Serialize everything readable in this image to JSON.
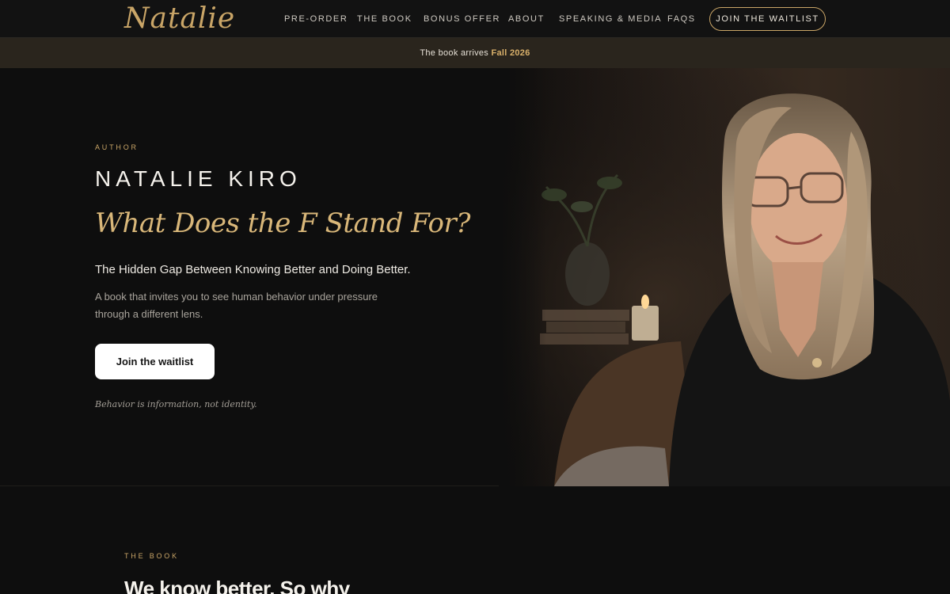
{
  "header": {
    "logo_text": "Natalie",
    "nav": [
      {
        "label": "PRE-ORDER"
      },
      {
        "label": "THE BOOK"
      },
      {
        "label": "BONUS OFFER"
      },
      {
        "label": "ABOUT"
      },
      {
        "label": "SPEAKING & MEDIA"
      },
      {
        "label": "FAQS"
      }
    ],
    "cta_label": "JOIN THE WAITLIST"
  },
  "announcement": {
    "text": "The book arrives",
    "highlight": "Fall 2026"
  },
  "hero": {
    "eyebrow": "AUTHOR",
    "name": "NATALIE KIRO",
    "title": "What Does the F Stand For?",
    "subtitle": "The Hidden Gap Between Knowing Better and Doing Better.",
    "description": "A book that invites you to see human behavior under pressure through a different lens.",
    "cta_label": "Join the waitlist",
    "tagline": "Behavior is information, not identity."
  },
  "book_section": {
    "eyebrow": "THE BOOK",
    "heading": "We know better. So why"
  },
  "colors": {
    "background": "#0e0e0e",
    "accent_gold": "#c9a567",
    "announcement_bar": "#2a251d",
    "button_bg": "#ffffff"
  }
}
